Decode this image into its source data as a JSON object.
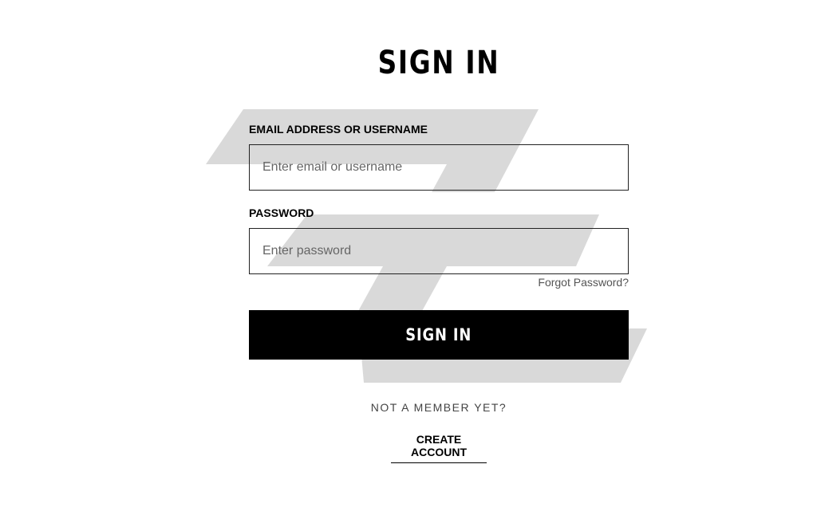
{
  "page": {
    "title": "SIGN IN"
  },
  "form": {
    "email_label": "EMAIL ADDRESS OR USERNAME",
    "email_placeholder": "Enter email or username",
    "email_value": "",
    "password_label": "PASSWORD",
    "password_placeholder": "Enter password",
    "password_value": "",
    "forgot_password": "Forgot Password?",
    "submit_label": "SIGN IN"
  },
  "footer": {
    "not_member": "NOT A MEMBER YET?",
    "create_account": "CREATE ACCOUNT"
  },
  "colors": {
    "background": "#ffffff",
    "button": "#000000",
    "watermark": "#d9d9d9"
  }
}
